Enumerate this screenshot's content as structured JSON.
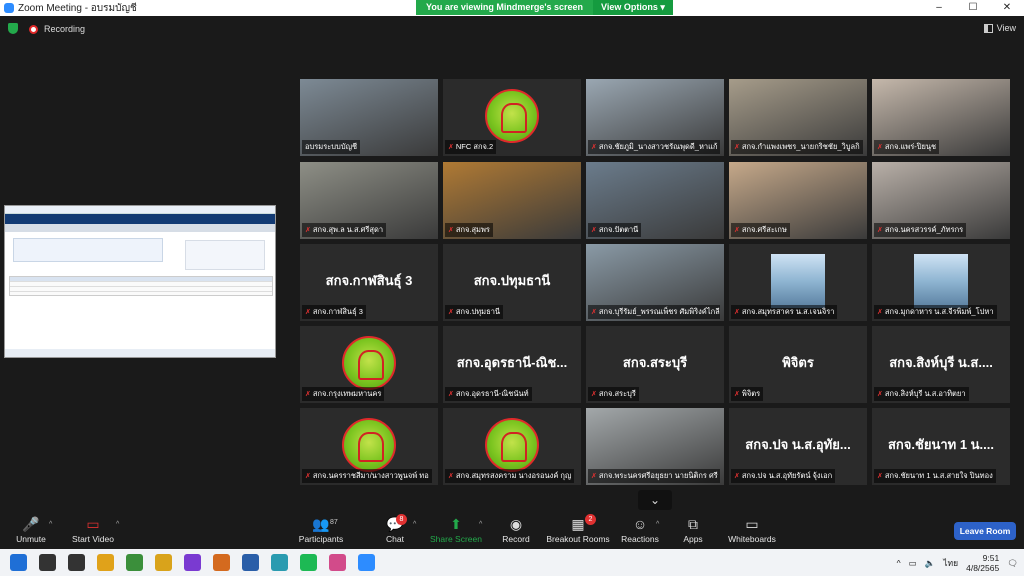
{
  "window": {
    "title": "Zoom Meeting - อบรมบัญชี",
    "share_banner": "You are viewing Mindmerge's screen",
    "view_options": "View Options",
    "recording": "Recording",
    "view": "View"
  },
  "gallery": [
    {
      "name": "อบรมระบบบัญชี",
      "type": "video",
      "active": true,
      "color": "#7d8a95"
    },
    {
      "name": "NFC สกจ.2",
      "type": "logo"
    },
    {
      "name": "สกจ.ชัยภูมิ_นางสาวชรัณพุดดี_หาแก้",
      "type": "video",
      "color": "#9aa7b2"
    },
    {
      "name": "สกจ.กำแพงเพชร_นายกริชชัย_วิบูลกิ",
      "type": "video",
      "color": "#a69c8a"
    },
    {
      "name": "สกจ.แพร่-ปิยนุช",
      "type": "video",
      "color": "#c5b8ab"
    },
    {
      "name": "สกจ.สุพ.ล น.ส.ศรีสุดา",
      "type": "video",
      "color": "#8e8f86"
    },
    {
      "name": "สกจ.สุมพร",
      "type": "video",
      "color": "#b07a34"
    },
    {
      "name": "สกจ.ปัตตานี",
      "type": "video",
      "color": "#6b7c8c"
    },
    {
      "name": "สกจ.ศรีสะเกษ",
      "type": "video",
      "color": "#c6a98a"
    },
    {
      "name": "สกจ.นครสวรรค์_ภัทรกร",
      "type": "video",
      "color": "#b9b0a8"
    },
    {
      "name": "สกจ.กาฬสินธุ์ 3",
      "type": "text",
      "big": "สกจ.กาฬสินธุ์ 3"
    },
    {
      "name": "สกจ.ปทุมธานี",
      "type": "text",
      "big": "สกจ.ปทุมธานี"
    },
    {
      "name": "สกจ.บุรีรัมย์_พรรณเพ็ชร ศัมพิริงค์ไกลีร์",
      "type": "video",
      "color": "#8a9aa6"
    },
    {
      "name": "สกจ.สมุทรสาคร น.ส.เจนจิรา",
      "type": "poster"
    },
    {
      "name": "สกจ.มุกดาหาร น.ส.จีรพิมพ์_โปหา",
      "type": "poster"
    },
    {
      "name": "สกจ.กรุงเทพมหานคร",
      "type": "logo"
    },
    {
      "name": "สกจ.อุดรธานี-ณิชนันท์",
      "type": "text",
      "big": "สกจ.อุดรธานี-ณิช..."
    },
    {
      "name": "สกจ.สระบุรี",
      "type": "text",
      "big": "สกจ.สระบุรี"
    },
    {
      "name": "พิจิตร",
      "type": "text",
      "big": "พิจิตร"
    },
    {
      "name": "สกจ.สิงห์บุรี น.ส.อาทิตยา",
      "type": "text",
      "big": "สกจ.สิงห์บุรี น.ส...."
    },
    {
      "name": "สกจ.นครราชสีมา/นางสาวพูนจพ์ ทอ",
      "type": "logo"
    },
    {
      "name": "สกจ.สมุทรสงคราม นางอรอนงค์ กุญ",
      "type": "logo"
    },
    {
      "name": "สกจ.พระนครศรีอยุธยา นายนิติกร ศรี",
      "type": "video",
      "color": "#a3a8aa"
    },
    {
      "name": "สกจ.ปจ น.ส.อุทัยรัตน์ จุ้งเอก",
      "type": "text",
      "big": "สกจ.ปจ น.ส.อุทัย..."
    },
    {
      "name": "สกจ.ชัยนาท 1 น.ส.สายใจ ปินทอง",
      "type": "text",
      "big": "สกจ.ชัยนาท 1 น...."
    }
  ],
  "toolbar": {
    "unmute": "Unmute",
    "start_video": "Start Video",
    "participants": "Participants",
    "participants_count": "87",
    "chat": "Chat",
    "chat_badge": "8",
    "share_screen": "Share Screen",
    "record": "Record",
    "breakout": "Breakout Rooms",
    "breakout_badge": "2",
    "reactions": "Reactions",
    "apps": "Apps",
    "whiteboards": "Whiteboards",
    "leave": "Leave Room"
  },
  "taskbar": {
    "language": "ไทย",
    "time": "9:51",
    "date": "4/8/2565",
    "apps": [
      {
        "name": "windows-start",
        "color": "#1f6fd6"
      },
      {
        "name": "search",
        "color": "#333"
      },
      {
        "name": "task-view",
        "color": "#333"
      },
      {
        "name": "chrome",
        "color": "#e0a21a"
      },
      {
        "name": "app-green",
        "color": "#3b8f3b"
      },
      {
        "name": "app-tool",
        "color": "#d9a31b"
      },
      {
        "name": "visual-studio",
        "color": "#7a3ad1"
      },
      {
        "name": "app-orange",
        "color": "#d46a1f"
      },
      {
        "name": "app-blue",
        "color": "#2a5ea8"
      },
      {
        "name": "app-teal",
        "color": "#2a9bb0"
      },
      {
        "name": "spotify",
        "color": "#1db954"
      },
      {
        "name": "itunes",
        "color": "#d24b8a"
      },
      {
        "name": "zoom",
        "color": "#2d8cff"
      }
    ]
  }
}
